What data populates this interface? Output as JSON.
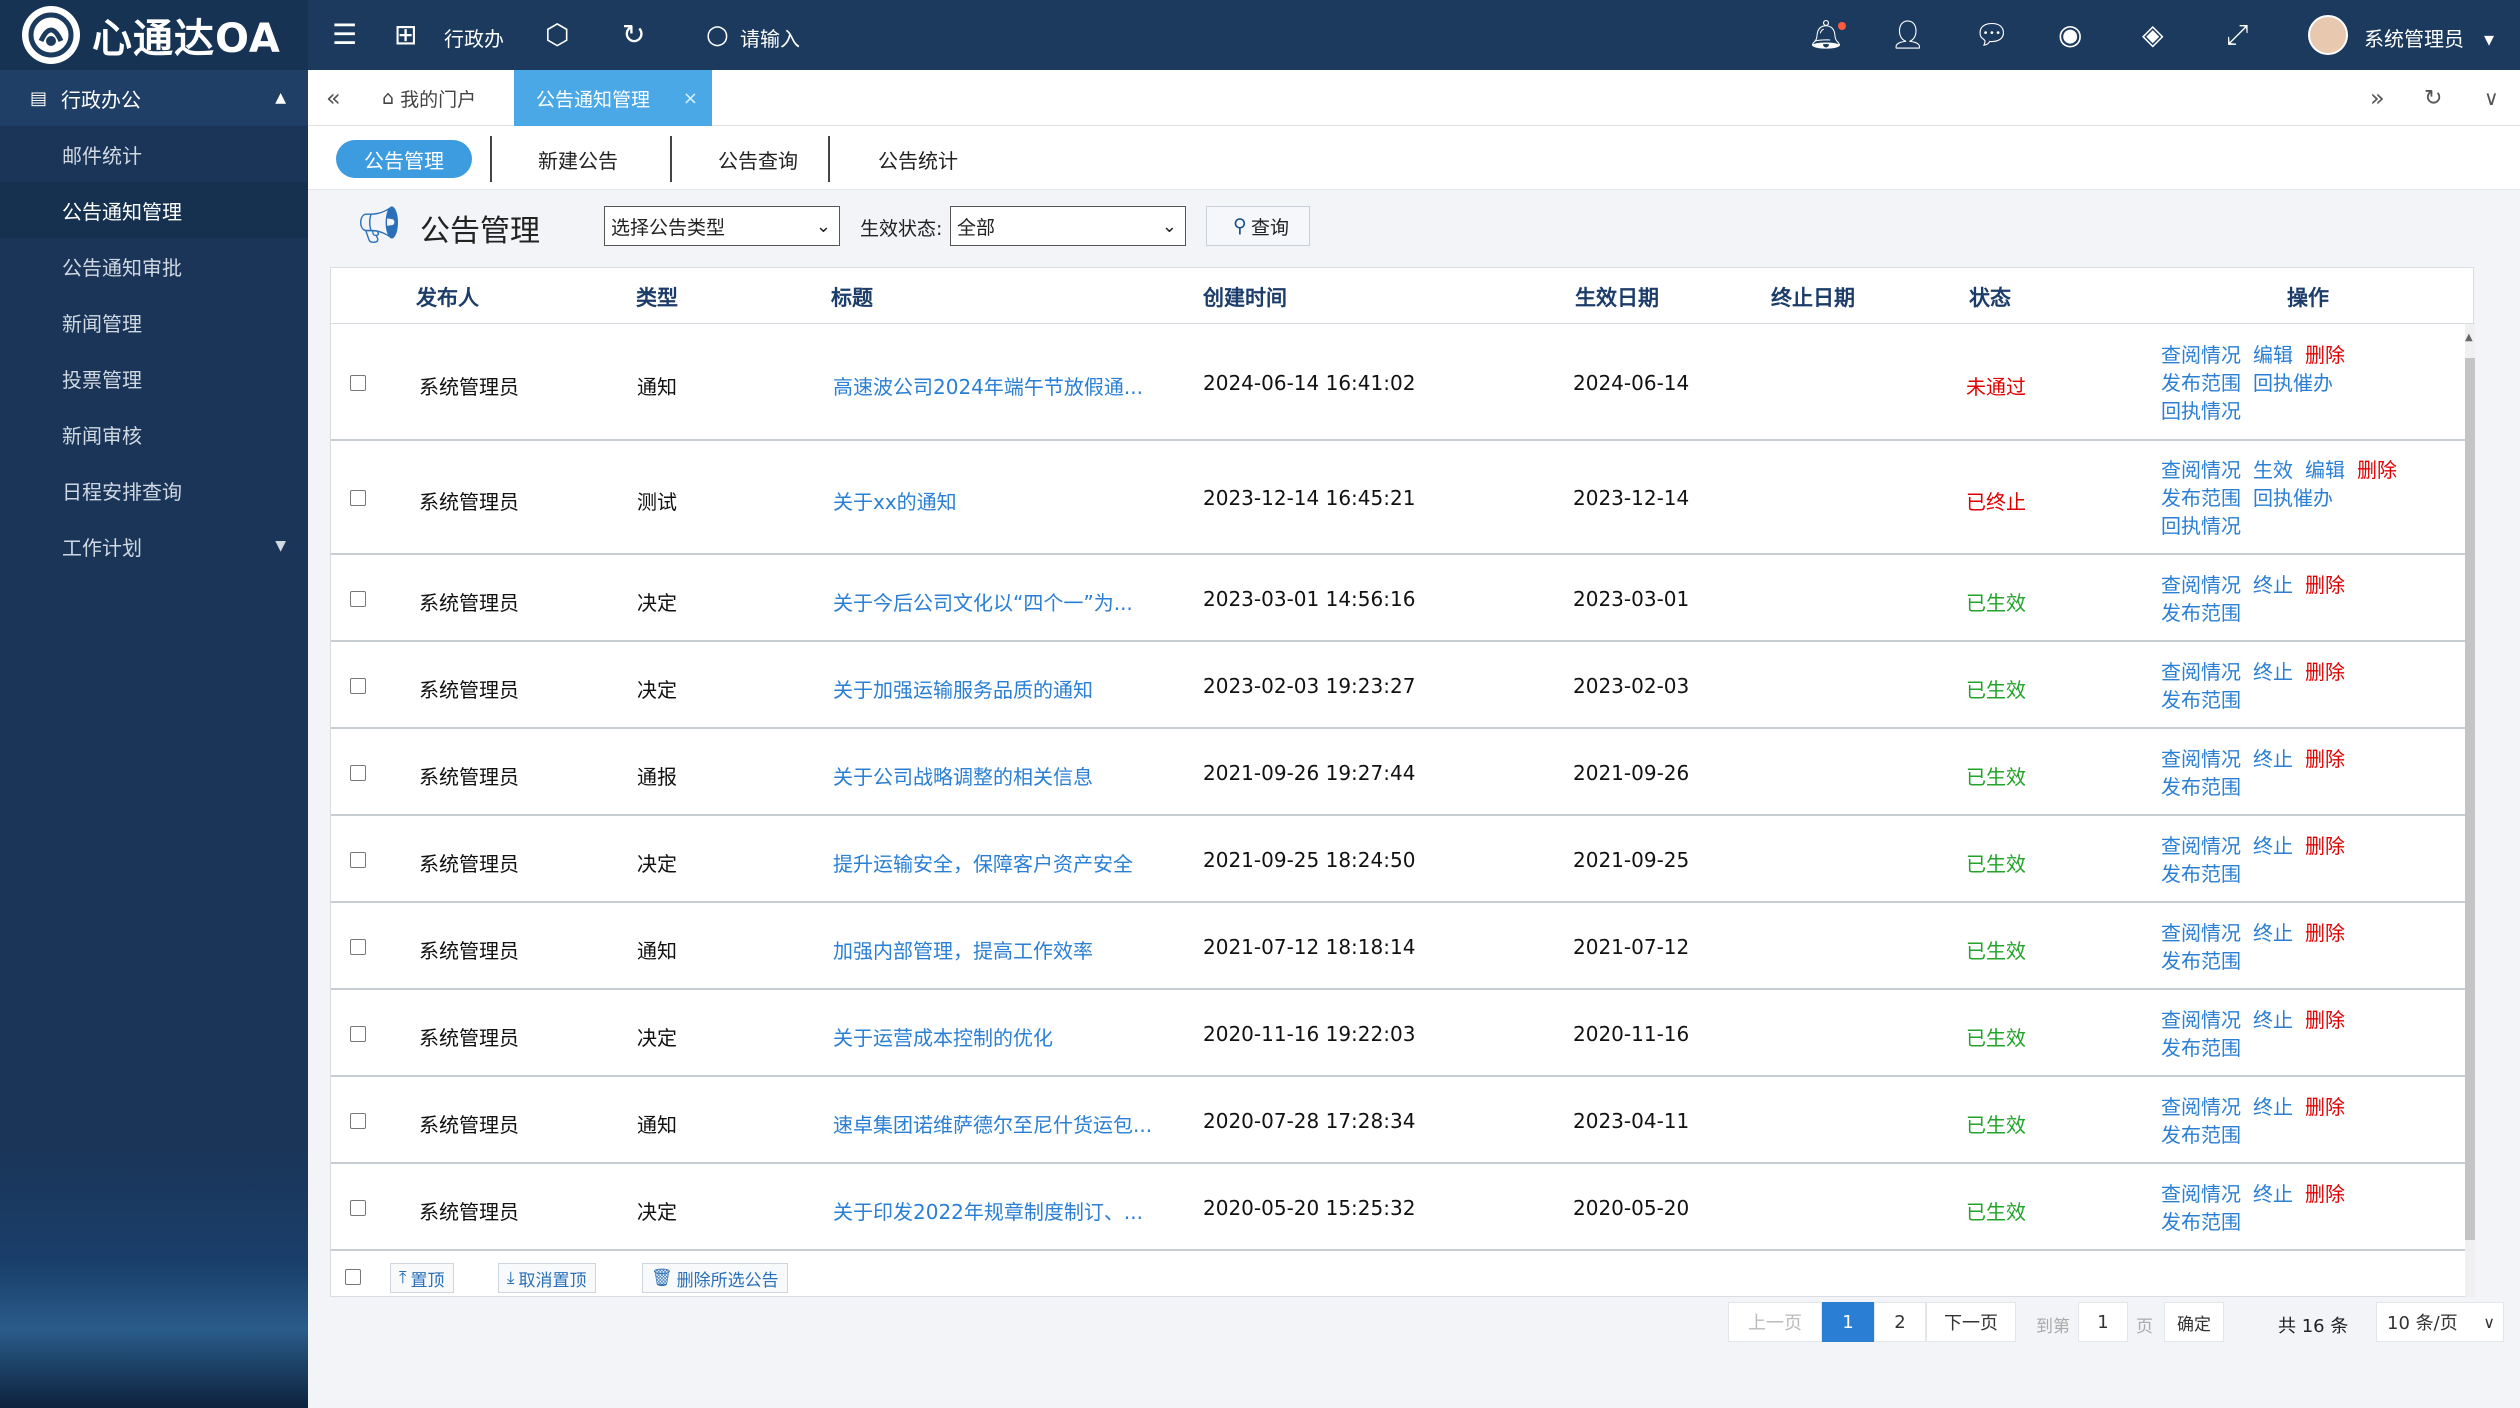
{
  "app": {
    "logo_text": "心通达OA",
    "module": "行政办",
    "search_placeholder": "请输入",
    "user": "系统管理员"
  },
  "sidebar": {
    "section": "行政办公",
    "items": [
      {
        "label": "邮件统计"
      },
      {
        "label": "公告通知管理"
      },
      {
        "label": "公告通知审批"
      },
      {
        "label": "新闻管理"
      },
      {
        "label": "投票管理"
      },
      {
        "label": "新闻审核"
      },
      {
        "label": "日程安排查询"
      },
      {
        "label": "工作计划"
      }
    ]
  },
  "tabs": {
    "home": "我的门户",
    "active": "公告通知管理",
    "close": "×"
  },
  "subtabs": [
    "公告管理",
    "新建公告",
    "公告查询",
    "公告统计"
  ],
  "filter": {
    "title": "公告管理",
    "type_select": "选择公告类型",
    "status_label": "生效状态:",
    "status_value": "全部",
    "query_button": "查询"
  },
  "table": {
    "headers": {
      "publisher": "发布人",
      "type": "类型",
      "title": "标题",
      "created": "创建时间",
      "effective": "生效日期",
      "end": "终止日期",
      "status": "状态",
      "ops": "操作"
    },
    "rows": [
      {
        "publisher": "系统管理员",
        "type": "通知",
        "title": "高速波公司2024年端午节放假通...",
        "created": "2024-06-14 16:41:02",
        "effective": "2024-06-14",
        "end": "",
        "status": "未通过",
        "ops": [
          [
            "查阅情况",
            "编辑",
            "删除"
          ],
          [
            "发布范围",
            "回执催办"
          ],
          [
            "回执情况"
          ]
        ]
      },
      {
        "publisher": "系统管理员",
        "type": "测试",
        "title": "关于xx的通知",
        "created": "2023-12-14 16:45:21",
        "effective": "2023-12-14",
        "end": "",
        "status": "已终止",
        "ops": [
          [
            "查阅情况",
            "生效",
            "编辑",
            "删除"
          ],
          [
            "发布范围",
            "回执催办"
          ],
          [
            "回执情况"
          ]
        ]
      },
      {
        "publisher": "系统管理员",
        "type": "决定",
        "title": "关于今后公司文化以“四个一”为...",
        "created": "2023-03-01 14:56:16",
        "effective": "2023-03-01",
        "end": "",
        "status": "已生效",
        "ops": [
          [
            "查阅情况",
            "终止",
            "删除"
          ],
          [
            "发布范围"
          ]
        ]
      },
      {
        "publisher": "系统管理员",
        "type": "决定",
        "title": "关于加强运输服务品质的通知",
        "created": "2023-02-03 19:23:27",
        "effective": "2023-02-03",
        "end": "",
        "status": "已生效",
        "ops": [
          [
            "查阅情况",
            "终止",
            "删除"
          ],
          [
            "发布范围"
          ]
        ]
      },
      {
        "publisher": "系统管理员",
        "type": "通报",
        "title": "关于公司战略调整的相关信息",
        "created": "2021-09-26 19:27:44",
        "effective": "2021-09-26",
        "end": "",
        "status": "已生效",
        "ops": [
          [
            "查阅情况",
            "终止",
            "删除"
          ],
          [
            "发布范围"
          ]
        ]
      },
      {
        "publisher": "系统管理员",
        "type": "决定",
        "title": "提升运输安全，保障客户资产安全",
        "created": "2021-09-25 18:24:50",
        "effective": "2021-09-25",
        "end": "",
        "status": "已生效",
        "ops": [
          [
            "查阅情况",
            "终止",
            "删除"
          ],
          [
            "发布范围"
          ]
        ]
      },
      {
        "publisher": "系统管理员",
        "type": "通知",
        "title": "加强内部管理，提高工作效率",
        "created": "2021-07-12 18:18:14",
        "effective": "2021-07-12",
        "end": "",
        "status": "已生效",
        "ops": [
          [
            "查阅情况",
            "终止",
            "删除"
          ],
          [
            "发布范围"
          ]
        ]
      },
      {
        "publisher": "系统管理员",
        "type": "决定",
        "title": "关于运营成本控制的优化",
        "created": "2020-11-16 19:22:03",
        "effective": "2020-11-16",
        "end": "",
        "status": "已生效",
        "ops": [
          [
            "查阅情况",
            "终止",
            "删除"
          ],
          [
            "发布范围"
          ]
        ]
      },
      {
        "publisher": "系统管理员",
        "type": "通知",
        "title": "速卓集团诺维萨德尔至尼什货运包...",
        "created": "2020-07-28 17:28:34",
        "effective": "2023-04-11",
        "end": "",
        "status": "已生效",
        "ops": [
          [
            "查阅情况",
            "终止",
            "删除"
          ],
          [
            "发布范围"
          ]
        ]
      },
      {
        "publisher": "系统管理员",
        "type": "决定",
        "title": "关于印发2022年规章制度制订、...",
        "created": "2020-05-20 15:25:32",
        "effective": "2020-05-20",
        "end": "",
        "status": "已生效",
        "ops": [
          [
            "查阅情况",
            "终止",
            "删除"
          ],
          [
            "发布范围"
          ]
        ]
      }
    ]
  },
  "footer": {
    "pin": "置顶",
    "unpin": "取消置顶",
    "delete_selected": "删除所选公告"
  },
  "pager": {
    "prev": "上一页",
    "pages": [
      "1",
      "2"
    ],
    "next": "下一页",
    "goto_label": "到第",
    "goto_value": "1",
    "page_unit": "页",
    "confirm": "确定",
    "total": "共 16 条",
    "page_size": "10 条/页"
  },
  "colors": {
    "topbar": "#1b3a5e",
    "sidebar": "#1a3558",
    "active_tab": "#4aa8e6",
    "link": "#2a7fd4",
    "red": "#e00000",
    "green": "#22a32a"
  }
}
